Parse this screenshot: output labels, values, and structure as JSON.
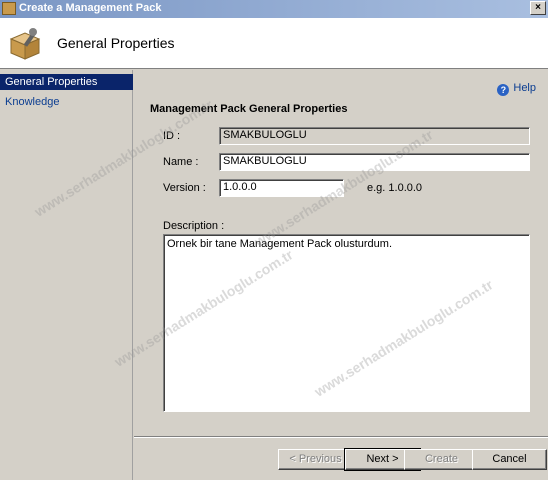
{
  "window": {
    "title": "Create a Management Pack",
    "close_glyph": "×"
  },
  "header": {
    "title": "General Properties",
    "icon": "package-wrench-icon"
  },
  "sidebar": {
    "items": [
      {
        "label": "General Properties",
        "active": true
      },
      {
        "label": "Knowledge",
        "active": false
      }
    ]
  },
  "help": {
    "label": "Help",
    "glyph": "?"
  },
  "section": {
    "title": "Management Pack General Properties"
  },
  "form": {
    "id_label": "ID :",
    "id_value": "SMAKBULOGLU",
    "name_label": "Name :",
    "name_value": "SMAKBULOGLU",
    "version_label": "Version :",
    "version_value": "1.0.0.0",
    "version_hint": "e.g. 1.0.0.0",
    "description_label": "Description :",
    "description_value": "Ornek bir tane Management Pack olusturdum."
  },
  "buttons": {
    "previous": "< Previous",
    "next": "Next >",
    "create": "Create",
    "cancel": "Cancel"
  },
  "watermark": {
    "text": "www.serhadmakbuloglu.com.tr"
  }
}
